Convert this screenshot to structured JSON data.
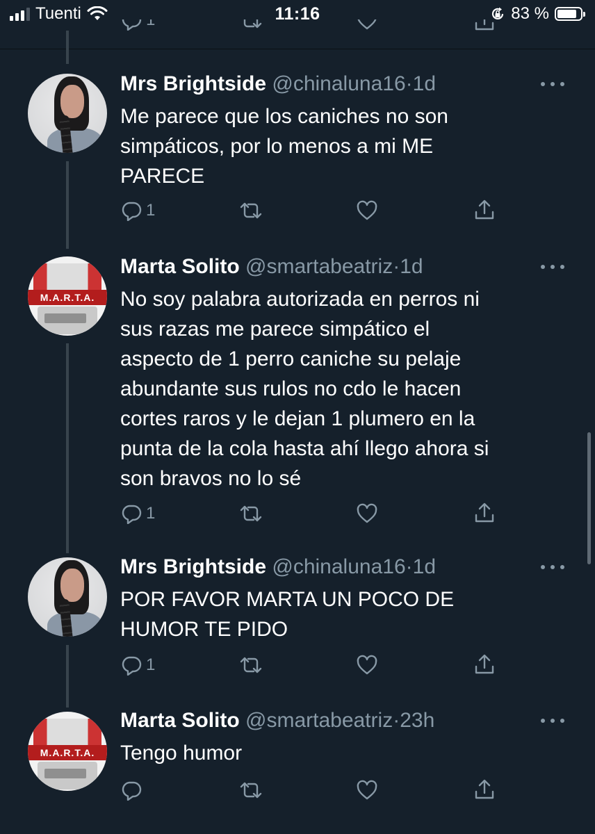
{
  "status_bar": {
    "carrier": "Tuenti",
    "time": "11:16",
    "battery_percent": "83 %",
    "battery_level": 0.83,
    "icons": [
      "signal-icon",
      "wifi-icon",
      "orientation-lock-icon",
      "battery-icon"
    ]
  },
  "previous_tweet": {
    "reply_count": "1"
  },
  "tweets": [
    {
      "name": "Mrs Brightside",
      "handle": "@chinaluna16",
      "separator": "·",
      "time": "1d",
      "text": "Me parece que los caniches no son\nsimpáticos, por lo menos a mi ME\nPARECE",
      "reply_count": "1",
      "avatar": "girl-with-braid"
    },
    {
      "name": "Marta Solito",
      "handle": "@smartabeatriz",
      "separator": "·",
      "time": "1d",
      "text": "No soy palabra autorizada en perros ni\nsus razas me parece simpático el\naspecto de 1 perro caniche su pelaje\nabundante sus rulos no cdo le hacen\ncortes raros y le dejan 1 plumero en la\npunta de la cola hasta ahí llego ahora si\nson bravos no lo sé",
      "reply_count": "1",
      "avatar": "marta-logo",
      "avatar_text": "M.A.R.T.A."
    },
    {
      "name": "Mrs Brightside",
      "handle": "@chinaluna16",
      "separator": "·",
      "time": "1d",
      "text": "POR FAVOR MARTA UN POCO DE\nHUMOR TE PIDO",
      "reply_count": "1",
      "avatar": "girl-with-braid"
    },
    {
      "name": "Marta Solito",
      "handle": "@smartabeatriz",
      "separator": "·",
      "time": "23h",
      "text": "Tengo humor",
      "reply_count": "",
      "avatar": "marta-logo",
      "avatar_text": "M.A.R.T.A."
    }
  ],
  "colors": {
    "background": "#15202b",
    "secondary_text": "#8899a6",
    "thread_line": "#38444d",
    "avatar_banner": "#b31d1d"
  }
}
